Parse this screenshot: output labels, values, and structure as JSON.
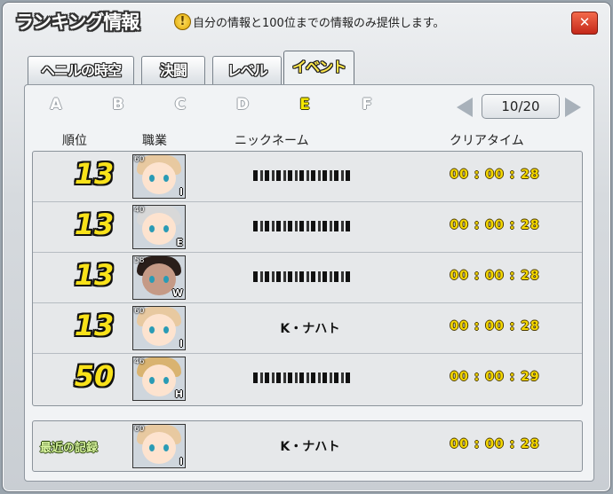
{
  "window": {
    "title": "ランキング情報",
    "notice": "自分の情報と100位までの情報のみ提供します。",
    "close_label": "✕"
  },
  "tabs": [
    {
      "label": "ヘニルの時空",
      "active": false
    },
    {
      "label": "決闘",
      "active": false
    },
    {
      "label": "レベル",
      "active": false
    },
    {
      "label": "イベント",
      "active": true
    }
  ],
  "subtabs": [
    {
      "label": "A",
      "active": false
    },
    {
      "label": "B",
      "active": false
    },
    {
      "label": "C",
      "active": false
    },
    {
      "label": "D",
      "active": false
    },
    {
      "label": "E",
      "active": true
    },
    {
      "label": "F",
      "active": false
    }
  ],
  "pager": {
    "display": "10/20"
  },
  "headers": {
    "rank": "順位",
    "job": "職業",
    "nickname": "ニックネーム",
    "clear_time": "クリアタイム"
  },
  "rows": [
    {
      "rank": "13",
      "level": "60",
      "job": "I",
      "nickname": "",
      "nickname_obscured": true,
      "time": "00 : 00 : 28",
      "hair": "#e8c9a0",
      "skin": "#fde3cf"
    },
    {
      "rank": "13",
      "level": "40",
      "job": "E",
      "nickname": "",
      "nickname_obscured": true,
      "time": "00 : 00 : 28",
      "hair": "#d8d8d8",
      "skin": "#fde3cf"
    },
    {
      "rank": "13",
      "level": "58",
      "job": "W",
      "nickname": "",
      "nickname_obscured": true,
      "time": "00 : 00 : 28",
      "hair": "#2a1e1a",
      "skin": "#c59a86"
    },
    {
      "rank": "13",
      "level": "60",
      "job": "I",
      "nickname": "K・ナハト",
      "nickname_obscured": false,
      "time": "00 : 00 : 28",
      "hair": "#e8c9a0",
      "skin": "#fde3cf"
    },
    {
      "rank": "50",
      "level": "46",
      "job": "H",
      "nickname": "",
      "nickname_obscured": true,
      "time": "00 : 00 : 29",
      "hair": "#d9b370",
      "skin": "#fde3cf"
    }
  ],
  "record": {
    "label": "最近の記録",
    "level": "60",
    "job": "I",
    "nickname": "K・ナハト",
    "time": "00 : 00 : 28",
    "hair": "#e8c9a0",
    "skin": "#fde3cf"
  }
}
